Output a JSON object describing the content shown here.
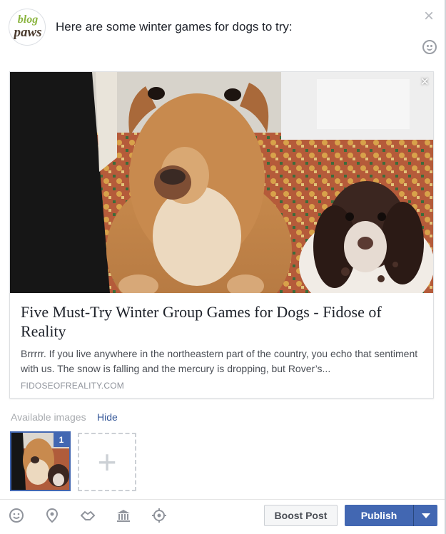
{
  "composer": {
    "avatar_text_top": "blog",
    "avatar_text_bottom": "paws",
    "post_text": "Here are some winter games for dogs to try:",
    "close_label": "×"
  },
  "link_card": {
    "title": "Five Must-Try Winter Group Games for Dogs - Fidose of Reality",
    "description": "Brrrrr. If you live anywhere in the northeastern part of the country, you echo that sentiment with us. The snow is falling and the mercury is dropping, but Rover’s...",
    "domain": "FIDOSEOFREALITY.COM",
    "image_close_label": "×"
  },
  "available_images": {
    "label": "Available images",
    "hide_label": "Hide",
    "selected_badge": "1",
    "add_label": "+"
  },
  "footer": {
    "icons": [
      "smiley-icon",
      "location-pin-icon",
      "handshake-icon",
      "bank-icon",
      "target-icon"
    ],
    "boost_label": "Boost Post",
    "publish_label": "Publish"
  },
  "colors": {
    "accent": "#4267b2",
    "link": "#365899",
    "muted_text": "#90949c"
  }
}
